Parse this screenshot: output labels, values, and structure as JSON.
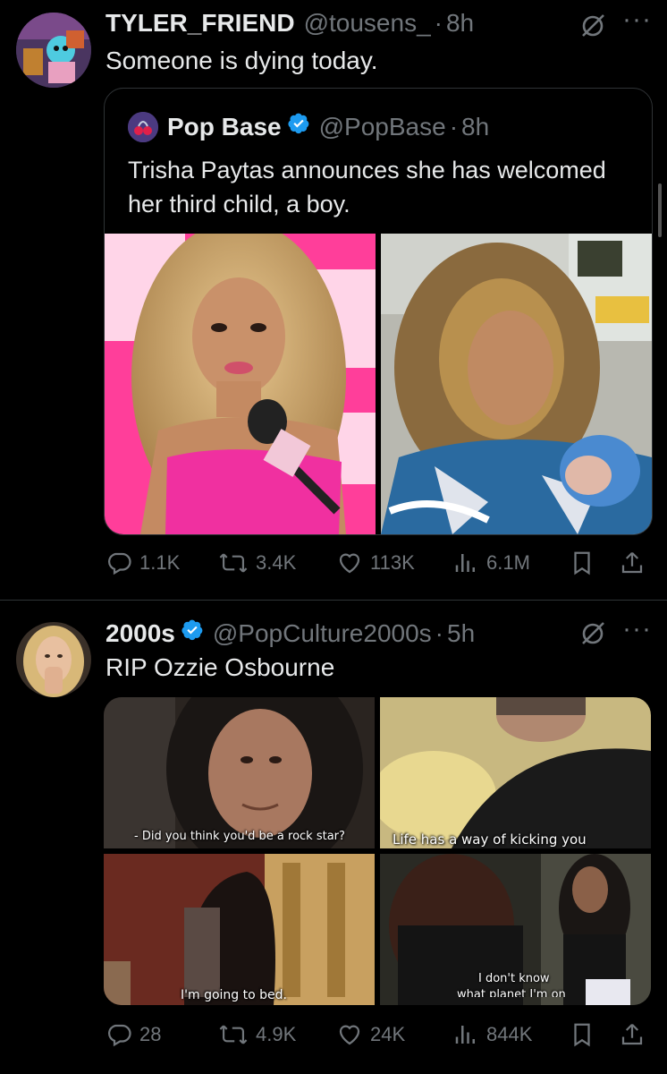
{
  "tweets": [
    {
      "author_name": "TYLER_FRIEND",
      "handle": "@tousens_",
      "time": "8h",
      "text": "Someone is dying today.",
      "quote": {
        "author_name": "Pop Base",
        "handle": "@PopBase",
        "time": "8h",
        "text_line1": "Trisha Paytas announces she has welcomed",
        "text_line2": "her third child, a boy."
      },
      "replies": "1.1K",
      "reposts": "3.4K",
      "likes": "113K",
      "views": "6.1M"
    },
    {
      "author_name": "2000s",
      "handle": "@PopCulture2000s",
      "time": "5h",
      "text": "RIP Ozzie Osbourne",
      "captions": [
        "- Did you think you'd be a rock star?",
        "Life has a way of kicking you",
        "I'm going to bed.",
        "I don't know",
        "what planet I'm on"
      ],
      "replies": "28",
      "reposts": "4.9K",
      "likes": "24K",
      "views": "844K"
    }
  ],
  "colors": {
    "background": "#000000",
    "text": "#e7e9ea",
    "muted": "#71767b",
    "verified": "#1d9bf0",
    "border": "#2f3336"
  },
  "icons": [
    "grok-icon",
    "more-icon",
    "reply-icon",
    "repost-icon",
    "like-icon",
    "views-icon",
    "bookmark-icon",
    "share-icon",
    "verified-icon"
  ]
}
